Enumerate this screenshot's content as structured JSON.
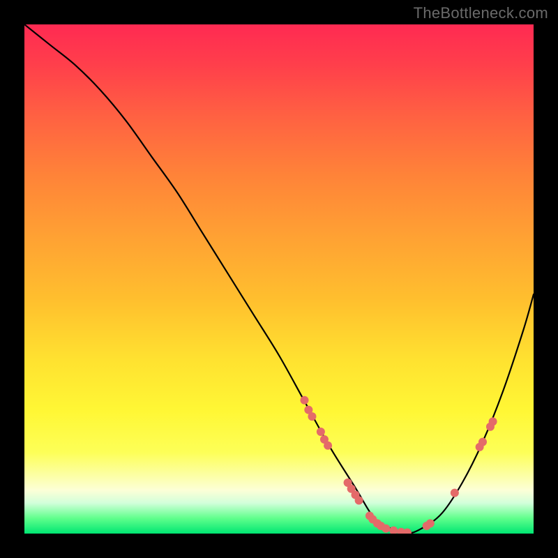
{
  "watermark": "TheBottleneck.com",
  "colors": {
    "background": "#000000",
    "gradient_top": "#ff2a52",
    "gradient_bottom": "#00e672",
    "curve": "#000000",
    "marker": "#e46a69",
    "watermark_text": "#6a6a6a"
  },
  "chart_data": {
    "type": "line",
    "title": "",
    "xlabel": "",
    "ylabel": "",
    "xlim": [
      0,
      100
    ],
    "ylim": [
      0,
      100
    ],
    "series": [
      {
        "name": "bottleneck-curve",
        "x": [
          0,
          5,
          10,
          15,
          20,
          25,
          30,
          35,
          40,
          45,
          50,
          55,
          60,
          65,
          68,
          70,
          72,
          75,
          78,
          82,
          86,
          90,
          94,
          98,
          100
        ],
        "y": [
          100,
          96,
          92,
          87,
          81,
          74,
          67,
          59,
          51,
          43,
          35,
          26,
          17,
          9,
          4,
          2,
          1,
          0,
          1,
          4,
          10,
          18,
          28,
          40,
          47
        ]
      }
    ],
    "markers": [
      {
        "x": 55.0,
        "y": 26.2
      },
      {
        "x": 55.8,
        "y": 24.3
      },
      {
        "x": 56.5,
        "y": 23.0
      },
      {
        "x": 58.2,
        "y": 20.0
      },
      {
        "x": 58.9,
        "y": 18.5
      },
      {
        "x": 59.6,
        "y": 17.3
      },
      {
        "x": 63.5,
        "y": 10.0
      },
      {
        "x": 64.2,
        "y": 8.8
      },
      {
        "x": 65.0,
        "y": 7.6
      },
      {
        "x": 65.7,
        "y": 6.5
      },
      {
        "x": 67.8,
        "y": 3.5
      },
      {
        "x": 68.4,
        "y": 2.8
      },
      {
        "x": 69.3,
        "y": 2.0
      },
      {
        "x": 70.0,
        "y": 1.5
      },
      {
        "x": 71.0,
        "y": 1.0
      },
      {
        "x": 72.5,
        "y": 0.6
      },
      {
        "x": 74.0,
        "y": 0.3
      },
      {
        "x": 75.2,
        "y": 0.2
      },
      {
        "x": 79.0,
        "y": 1.5
      },
      {
        "x": 79.7,
        "y": 2.0
      },
      {
        "x": 84.5,
        "y": 8.0
      },
      {
        "x": 89.4,
        "y": 17.0
      },
      {
        "x": 90.0,
        "y": 18.0
      },
      {
        "x": 91.5,
        "y": 21.0
      },
      {
        "x": 92.0,
        "y": 22.0
      }
    ]
  }
}
